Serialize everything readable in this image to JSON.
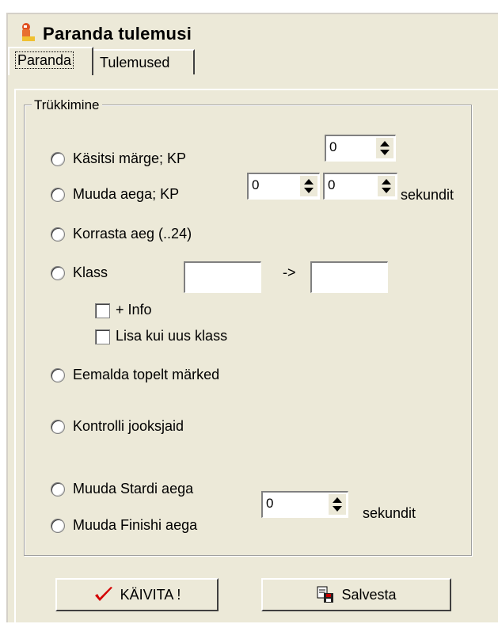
{
  "window": {
    "title": "Paranda tulemusi"
  },
  "tabs": [
    {
      "label": "Paranda",
      "active": true
    },
    {
      "label": "Tulemused",
      "active": false
    }
  ],
  "group": {
    "legend": "Trükkimine",
    "options": {
      "manual_mark": "Käsitsi märge; KP",
      "change_time": "Muuda aega; KP",
      "fix_time": "Korrasta aeg (..24)",
      "class": "Klass",
      "remove_duplicates": "Eemalda topelt märked",
      "check_runners": "Kontrolli jooksjaid",
      "change_start": "Muuda Stardi aega",
      "change_finish": "Muuda Finishi aega"
    },
    "checkboxes": {
      "info": "+ Info",
      "add_new_class": "Lisa kui uus klass"
    },
    "fields": {
      "manual_mark_kp": "0",
      "change_time_kp": "0",
      "change_time_seconds": "0",
      "class_from": "",
      "class_arrow": "->",
      "class_to": "",
      "start_finish_seconds": "0",
      "seconds_label": "sekundit",
      "seconds_label_2": "sekundit"
    }
  },
  "buttons": {
    "run": "KÄIVITA !",
    "save": "Salvesta"
  },
  "colors": {
    "face": "#ece9d8",
    "check": "#d40000"
  },
  "icons": {
    "title": "app-icon",
    "run": "checkmark-icon",
    "save": "save-icon"
  }
}
